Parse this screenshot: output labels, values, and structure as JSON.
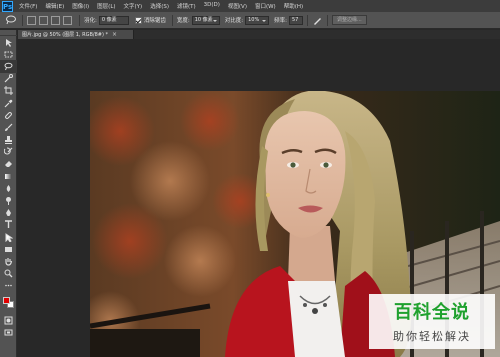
{
  "app": {
    "logo": "Ps"
  },
  "menu": [
    "文件(F)",
    "编辑(E)",
    "图像(I)",
    "图层(L)",
    "文字(Y)",
    "选择(S)",
    "滤镜(T)",
    "3D(D)",
    "视图(V)",
    "窗口(W)",
    "帮助(H)"
  ],
  "options": {
    "feather_label": "羽化:",
    "feather_value": "0 像素",
    "antialias_label": "消除锯齿",
    "width_label": "宽度:",
    "width_value": "10 像素",
    "contrast_label": "对比度:",
    "contrast_value": "10%",
    "frequency_label": "频率:",
    "frequency_value": "57",
    "refine_edge_label": "调整边缘..."
  },
  "document": {
    "tab_label": "图片.jpg @ 50% (图层 1, RGB/8#) *",
    "close_label": "×"
  },
  "colors": {
    "foreground": "#e00000",
    "background": "#ffffff"
  },
  "tools": [
    "move-icon",
    "marquee-icon",
    "magnetic-lasso-icon",
    "quick-select-icon",
    "crop-icon",
    "eyedropper-icon",
    "healing-brush-icon",
    "brush-icon",
    "clone-stamp-icon",
    "history-brush-icon",
    "eraser-icon",
    "gradient-icon",
    "blur-icon",
    "dodge-icon",
    "pen-icon",
    "type-icon",
    "path-select-icon",
    "rectangle-icon",
    "hand-icon",
    "zoom-icon"
  ],
  "watermark": {
    "title": "百科全说",
    "subtitle": "助你轻松解决"
  }
}
